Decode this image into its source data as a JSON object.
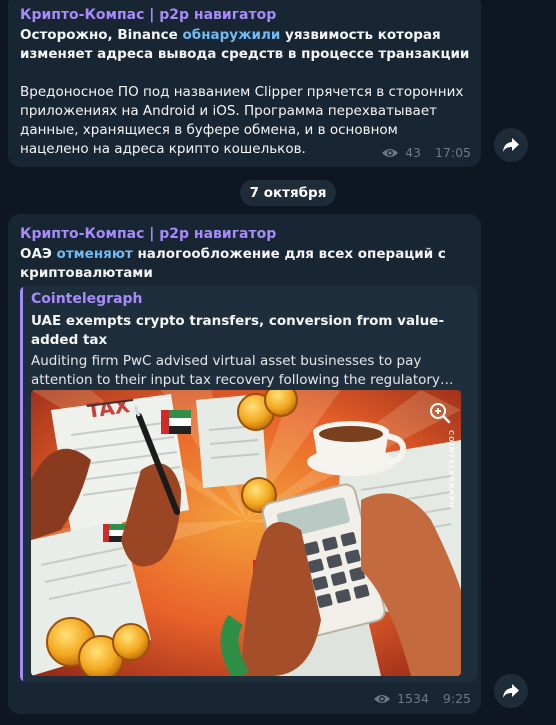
{
  "channel_name": "Крипто-Компас | p2p навигатор",
  "post1": {
    "headline_part1": "Осторожно, Binance ",
    "headline_link": "обнаружили",
    "headline_part2": " уязвимость которая изменяет адреса вывода средств в процессе транзакции",
    "body": "Вредоносное ПО под названием Clipper прячется в сторонних приложениях на Android и iOS. Программа перехватывает данные, хранящиеся в буфере обмена, и в основном нацелено на адреса крипто кошельков.",
    "views": "43",
    "time": "17:05"
  },
  "date_separator": "7 октября",
  "post2": {
    "headline_part1": "ОАЭ ",
    "headline_link": "отменяют",
    "headline_part2": " налогообложение для всех операций с криптовалютами",
    "preview": {
      "site": "Cointelegraph",
      "title": "UAE exempts crypto transfers, conversion from value-added tax",
      "description": "Auditing firm PwC advised virtual asset businesses to pay attention to their input tax recovery following the regulatory update.",
      "image_stamp_text": "TAX",
      "image_watermark": "COINTELEGRAPH"
    },
    "views": "1534",
    "time": "9:25"
  },
  "colors": {
    "background": "#0e1621",
    "bubble": "#182533",
    "channel_name": "#a78bfa",
    "link": "#71baf2",
    "meta": "#6c7883",
    "image_background": "#e8622a"
  },
  "icons": {
    "views": "eye-icon",
    "share": "share-arrow-icon",
    "zoom": "zoom-in-icon"
  }
}
